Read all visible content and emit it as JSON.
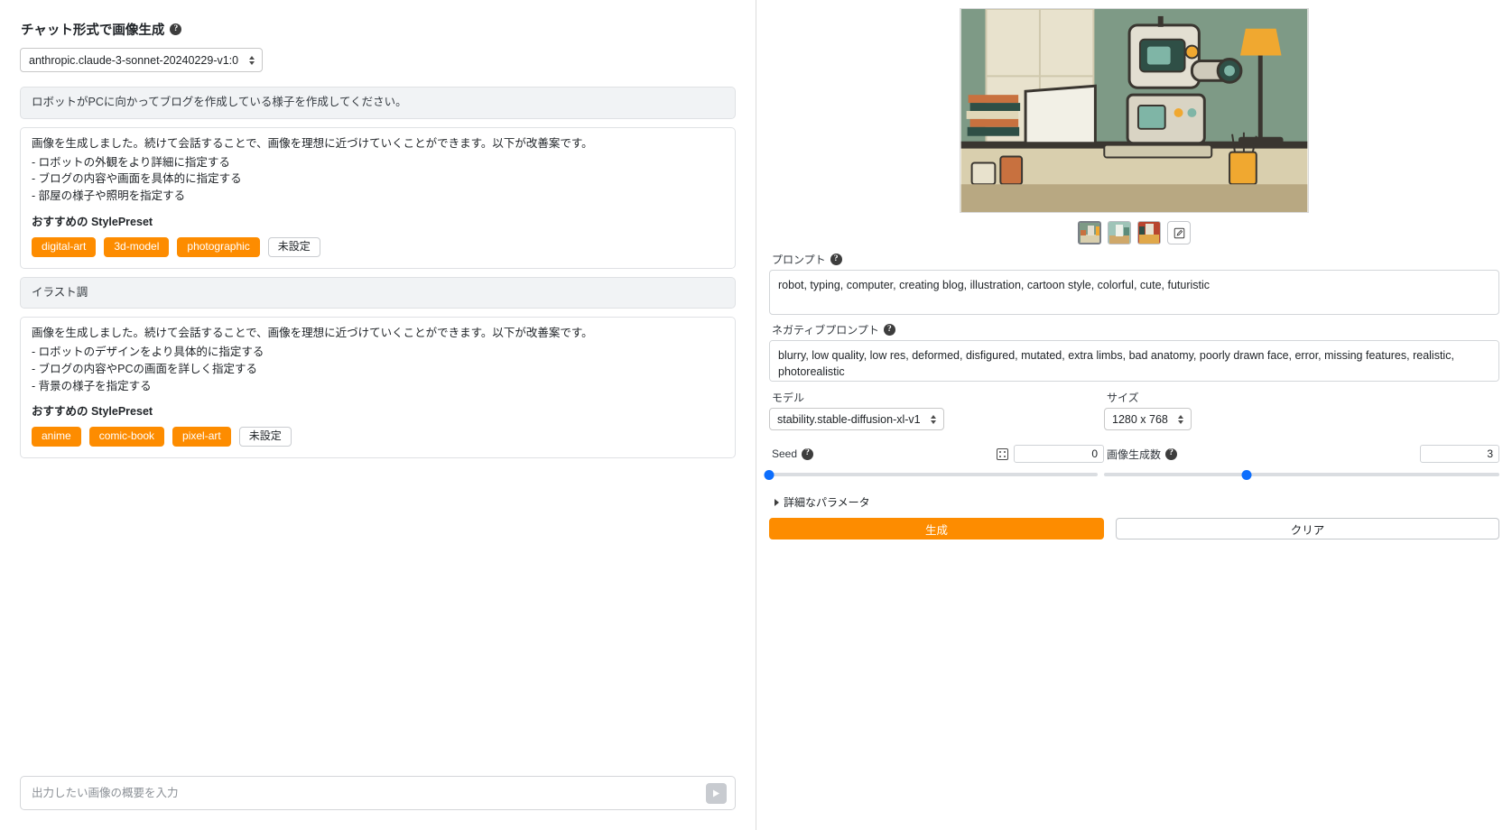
{
  "left": {
    "title": "チャット形式で画像生成",
    "help_icon": "help-circle-icon",
    "model_value": "anthropic.claude-3-sonnet-20240229-v1:0",
    "messages": [
      {
        "role": "user",
        "text": "ロボットがPCに向かってブログを作成している様子を作成してください。"
      },
      {
        "role": "assistant",
        "intro": "画像を生成しました。続けて会話することで、画像を理想に近づけていくことができます。以下が改善案です。",
        "bullets": [
          "- ロボットの外観をより詳細に指定する",
          "- ブログの内容や画面を具体的に指定する",
          "- 部屋の様子や照明を指定する"
        ],
        "preset_heading": "おすすめの StylePreset",
        "presets": [
          "digital-art",
          "3d-model",
          "photographic"
        ],
        "preset_none": "未設定"
      },
      {
        "role": "user",
        "text": "イラスト調"
      },
      {
        "role": "assistant",
        "intro": "画像を生成しました。続けて会話することで、画像を理想に近づけていくことができます。以下が改善案です。",
        "bullets": [
          "- ロボットのデザインをより具体的に指定する",
          "- ブログの内容やPCの画面を詳しく指定する",
          "- 背景の様子を指定する"
        ],
        "preset_heading": "おすすめの StylePreset",
        "presets": [
          "anime",
          "comic-book",
          "pixel-art"
        ],
        "preset_none": "未設定"
      }
    ],
    "chat_input_placeholder": "出力したい画像の概要を入力",
    "chat_input_value": "",
    "send_icon": "send-triangle-icon"
  },
  "right": {
    "preview_alt": "robot-typing-on-computer-illustration",
    "thumbnails": [
      "thumbnail-1",
      "thumbnail-2",
      "thumbnail-3"
    ],
    "selected_thumbnail_index": 0,
    "edit_icon": "edit-square-icon",
    "prompt_label": "プロンプト",
    "prompt_value": "robot, typing, computer, creating blog, illustration, cartoon style, colorful, cute, futuristic",
    "negative_label": "ネガティブプロンプト",
    "negative_value": "blurry, low quality, low res, deformed, disfigured, mutated, extra limbs, bad anatomy, poorly drawn face, error, missing features, realistic, photorealistic",
    "model_label": "モデル",
    "model_value": "stability.stable-diffusion-xl-v1",
    "size_label": "サイズ",
    "size_value": "1280 x 768",
    "seed_label": "Seed",
    "seed_value": "0",
    "seed_slider_percent": 0,
    "dice_icon": "dice-icon",
    "count_label": "画像生成数",
    "count_value": "3",
    "count_slider_percent": 36,
    "advanced_label": "詳細なパラメータ",
    "generate_label": "生成",
    "clear_label": "クリア",
    "accent_color": "#fd8c00",
    "slider_color": "#0d6efd"
  }
}
